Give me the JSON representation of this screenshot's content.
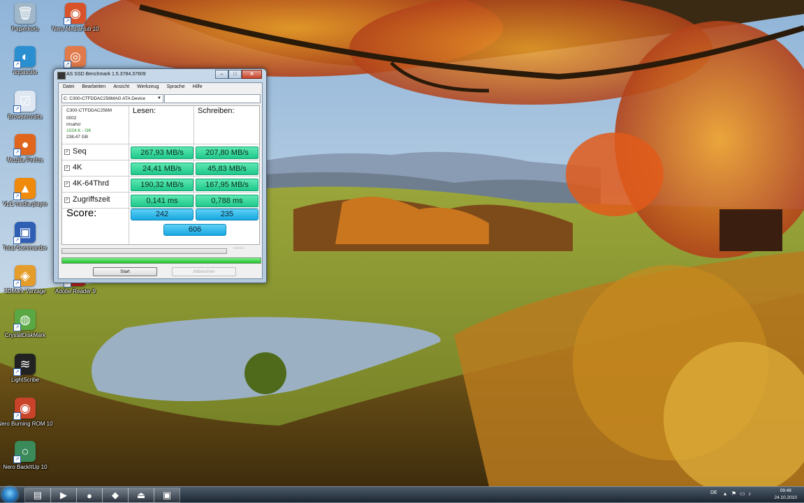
{
  "desktop": {
    "icons": [
      {
        "label": "Papierkorb",
        "icon": "recycle-bin-icon",
        "color": "#9fb7c9"
      },
      {
        "label": "Nero MediaHub 10",
        "icon": "nero-mediahub-icon",
        "color": "#d8532a"
      },
      {
        "label": "aquasuite",
        "icon": "aquasuite-icon",
        "color": "#2a8fd0"
      },
      {
        "label": "",
        "icon": "nero-app-icon",
        "color": "#e07a4a"
      },
      {
        "label": "Browsercrafts",
        "icon": "checklist-icon",
        "color": "#dfe8f2"
      },
      {
        "label": "Mozilla Firefox",
        "icon": "firefox-icon",
        "color": "#e0661e"
      },
      {
        "label": "VLC media player",
        "icon": "vlc-icon",
        "color": "#f08a0c"
      },
      {
        "label": "Total Commander",
        "icon": "floppy-icon",
        "color": "#2f5fb5"
      },
      {
        "label": "3DMark Vantage",
        "icon": "3dmark-icon",
        "color": "#e49d2a"
      },
      {
        "label": "Adobe Reader 9",
        "icon": "adobe-reader-icon",
        "color": "#b51e1e"
      },
      {
        "label": "CrystalDiskMark",
        "icon": "crystaldiskmark-icon",
        "color": "#5aa844"
      },
      {
        "label": "LightScribe",
        "icon": "lightscribe-icon",
        "color": "#222222"
      },
      {
        "label": "Nero Burning ROM 10",
        "icon": "nero-burning-rom-icon",
        "color": "#c9432a"
      },
      {
        "label": "Nero BackItUp 10",
        "icon": "nero-backitup-icon",
        "color": "#3a8a5a"
      }
    ]
  },
  "window": {
    "title": "AS SSD Benchmark 1.5.3784.37609",
    "controls": {
      "minimize": "–",
      "maximize": "□",
      "close": "✕"
    },
    "menu": [
      "Datei",
      "Bearbeiten",
      "Ansicht",
      "Werkzeug",
      "Sprache",
      "Hilfe"
    ],
    "device_select": "C: C300-CTFDDAC256MAG ATA Device",
    "info": {
      "model": "C300-CTFDDAC256M",
      "firmware": "0002",
      "driver": "msahci",
      "alignment": "1024 K - OK",
      "size": "238,47 GB"
    },
    "headers": {
      "read": "Lesen:",
      "write": "Schreiben:"
    },
    "rows": [
      {
        "label": "Seq",
        "checked": "✓",
        "read": "267,93 MB/s",
        "write": "207,80 MB/s"
      },
      {
        "label": "4K",
        "checked": "✓",
        "read": "24,41 MB/s",
        "write": "45,83 MB/s"
      },
      {
        "label": "4K-64Thrd",
        "checked": "✓",
        "read": "190,32 MB/s",
        "write": "167,95 MB/s"
      },
      {
        "label": "Zugriffszeit",
        "checked": "✓",
        "read": "0,141 ms",
        "write": "0,788 ms"
      }
    ],
    "score": {
      "label": "Score:",
      "read": "242",
      "write": "235",
      "total": "606"
    },
    "progress_text": "--:--:--",
    "overall_progress": 1.0,
    "buttons": {
      "start": "Start",
      "abort": "Abbrechen"
    },
    "colors": {
      "value_green": "#1fc88a",
      "score_blue": "#16a7e0",
      "progress_green": "#1fbe2a"
    }
  },
  "taskbar": {
    "items": [
      {
        "icon": "explorer-icon"
      },
      {
        "icon": "media-player-icon"
      },
      {
        "icon": "firefox-icon"
      },
      {
        "icon": "drive-icon"
      },
      {
        "icon": "eject-drive-icon"
      },
      {
        "icon": "floppy-icon"
      }
    ],
    "tray": {
      "language": "DE",
      "time": "09:48",
      "date": "24.10.2010"
    }
  }
}
